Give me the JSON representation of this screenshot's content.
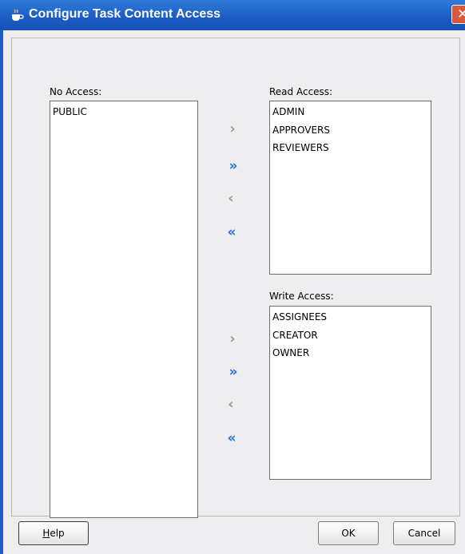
{
  "window": {
    "title": "Configure Task Content Access",
    "close_glyph": "✕"
  },
  "no_access": {
    "label": "No Access:",
    "items": [
      "PUBLIC"
    ]
  },
  "read_access": {
    "label": "Read Access:",
    "items": [
      "ADMIN",
      "APPROVERS",
      "REVIEWERS"
    ]
  },
  "write_access": {
    "label": "Write Access:",
    "items": [
      "ASSIGNEES",
      "CREATOR",
      "OWNER"
    ]
  },
  "arrows": {
    "move_right": "›",
    "move_all_right": "»",
    "move_left": "‹",
    "move_all_left": "«"
  },
  "buttons": {
    "help_mnemonic": "H",
    "help_rest": "elp",
    "ok": "OK",
    "cancel": "Cancel"
  },
  "colors": {
    "titlebar": "#1a5bc4",
    "double_arrow": "#2a6fd6",
    "single_arrow": "#9a9a9a"
  }
}
